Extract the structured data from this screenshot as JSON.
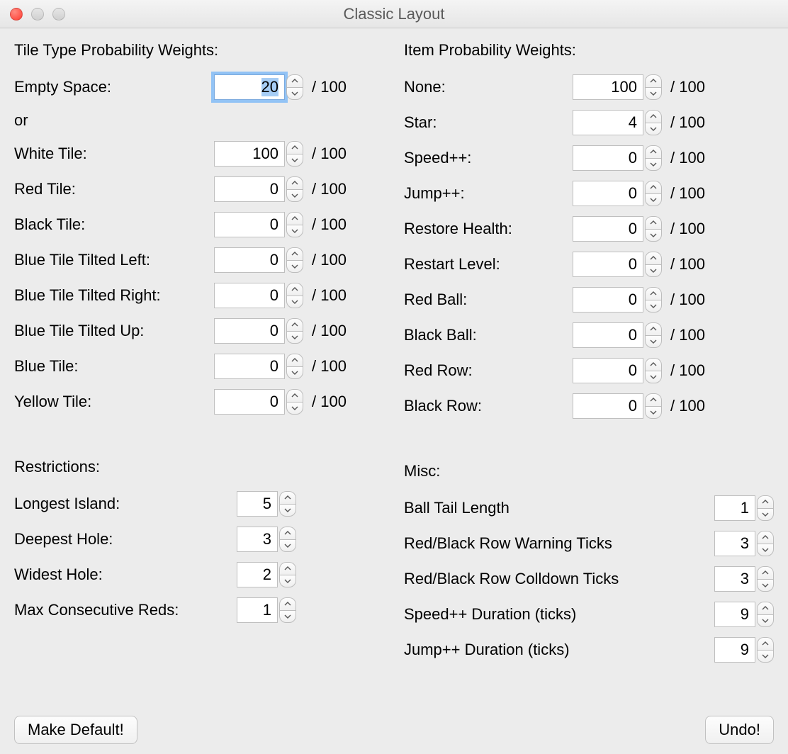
{
  "window": {
    "title": "Classic Layout"
  },
  "suffix100": "/ 100",
  "or_label": "or",
  "tile": {
    "title": "Tile Type Probability Weights:",
    "rows": [
      {
        "key": "empty",
        "label": "Empty Space:",
        "value": "20",
        "focused": true
      },
      {
        "key": "white",
        "label": "White Tile:",
        "value": "100"
      },
      {
        "key": "red",
        "label": "Red Tile:",
        "value": "0"
      },
      {
        "key": "black",
        "label": "Black Tile:",
        "value": "0"
      },
      {
        "key": "blue_tl",
        "label": "Blue Tile Tilted Left:",
        "value": "0"
      },
      {
        "key": "blue_tr",
        "label": "Blue Tile Tilted Right:",
        "value": "0"
      },
      {
        "key": "blue_tu",
        "label": "Blue Tile Tilted Up:",
        "value": "0"
      },
      {
        "key": "blue",
        "label": "Blue Tile:",
        "value": "0"
      },
      {
        "key": "yellow",
        "label": "Yellow Tile:",
        "value": "0"
      }
    ]
  },
  "item": {
    "title": "Item Probability Weights:",
    "rows": [
      {
        "key": "none",
        "label": "None:",
        "value": "100"
      },
      {
        "key": "star",
        "label": "Star:",
        "value": "4"
      },
      {
        "key": "speed",
        "label": "Speed++:",
        "value": "0"
      },
      {
        "key": "jump",
        "label": "Jump++:",
        "value": "0"
      },
      {
        "key": "restore",
        "label": "Restore Health:",
        "value": "0"
      },
      {
        "key": "restart",
        "label": "Restart Level:",
        "value": "0"
      },
      {
        "key": "redball",
        "label": "Red Ball:",
        "value": "0"
      },
      {
        "key": "blackball",
        "label": "Black Ball:",
        "value": "0"
      },
      {
        "key": "redrow",
        "label": "Red Row:",
        "value": "0"
      },
      {
        "key": "blackrow",
        "label": "Black Row:",
        "value": "0"
      }
    ]
  },
  "restrict": {
    "title": "Restrictions:",
    "rows": [
      {
        "key": "island",
        "label": "Longest Island:",
        "value": "5"
      },
      {
        "key": "deep",
        "label": "Deepest Hole:",
        "value": "3"
      },
      {
        "key": "wide",
        "label": "Widest Hole:",
        "value": "2"
      },
      {
        "key": "reds",
        "label": "Max Consecutive Reds:",
        "value": "1"
      }
    ]
  },
  "misc": {
    "title": "Misc:",
    "rows": [
      {
        "key": "tail",
        "label": "Ball Tail Length",
        "value": "1"
      },
      {
        "key": "warn",
        "label": "Red/Black Row Warning Ticks",
        "value": "3"
      },
      {
        "key": "cool",
        "label": "Red/Black Row Colldown Ticks",
        "value": "3"
      },
      {
        "key": "speedd",
        "label": "Speed++ Duration (ticks)",
        "value": "9"
      },
      {
        "key": "jumpd",
        "label": "Jump++ Duration (ticks)",
        "value": "9"
      }
    ]
  },
  "buttons": {
    "default": "Make Default!",
    "undo": "Undo!"
  }
}
